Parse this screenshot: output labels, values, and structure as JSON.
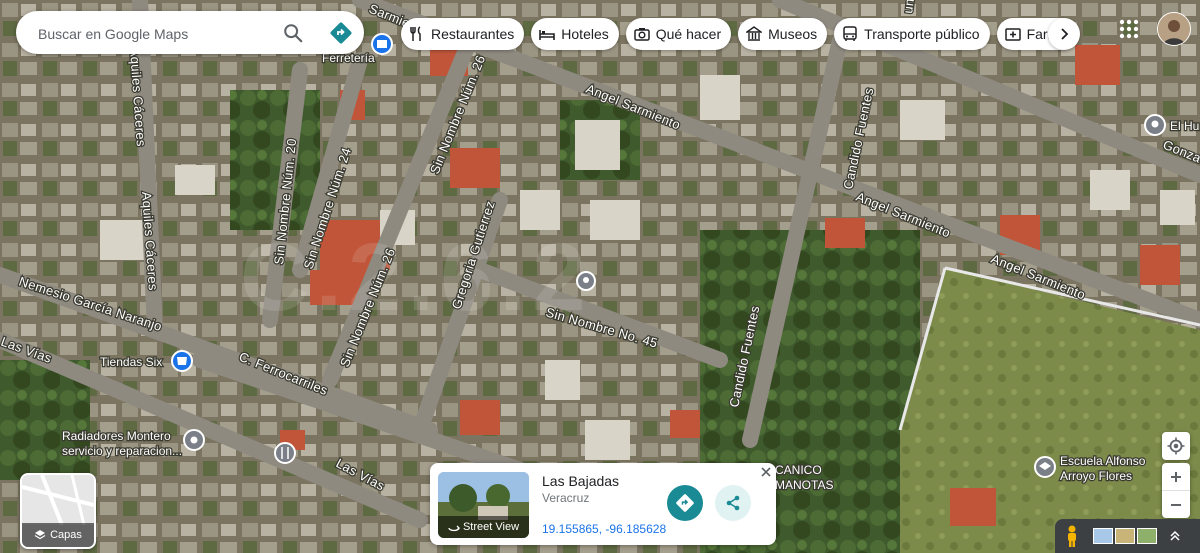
{
  "search": {
    "placeholder": "Buscar en Google Maps",
    "search_icon": "search-icon",
    "directions_icon": "directions-icon"
  },
  "chips": [
    {
      "label": "Restaurantes",
      "icon": "fork-knife-icon"
    },
    {
      "label": "Hoteles",
      "icon": "bed-icon"
    },
    {
      "label": "Qué hacer",
      "icon": "camera-icon"
    },
    {
      "label": "Museos",
      "icon": "museum-icon"
    },
    {
      "label": "Transporte público",
      "icon": "bus-icon"
    },
    {
      "label": "Farma",
      "icon": "pharmacy-icon"
    }
  ],
  "roads": {
    "angel_top": "Angel Sarmiento",
    "angel_mid": "Angel Sarmiento",
    "angel_right": "Angel Sarmiento",
    "angel_upper_left": "Sarmie",
    "aquiles_top": "Aquiles Cáceres",
    "aquiles_bottom": "Aquiles Cáceres",
    "sn20": "Sin Nombre Núm. 20",
    "sn24": "Sin Nombre Núm. 24",
    "sn26_top": "Sin Nombre Núm. 26",
    "sn26_mid": "Sin Nombre Núm. 26",
    "sn26_low": "Sin Nombre Núm. 26",
    "gregoria": "Gregoria Gutierrez",
    "sn45": "Sin Nombre No. 45",
    "candido_top": "Candido Fuentes",
    "candido_bottom": "Candido Fuentes",
    "nemesio": "Nemesio García Naranjo",
    "ferrocarriles": "C. Ferrocarriles",
    "vias_left": "Las Vías",
    "vias_bottom": "Las Vías",
    "gonza": "Gonza",
    "undi": "undi"
  },
  "places": {
    "ferreteria": "Ferretería",
    "tiendas_six": "Tiendas Six",
    "radiadores_1": "Radiadores Montero",
    "radiadores_2": "servicio y reparacion...",
    "el_hu": "El Hu",
    "escuela_1": "Escuela Alfonso",
    "escuela_2": "Arroyo Flores",
    "mecanico_1": "CANICO",
    "mecanico_2": "MANOTAS"
  },
  "watermark": "C.2.6.2",
  "layers": {
    "label": "Capas"
  },
  "card": {
    "title": "Las Bajadas",
    "subtitle": "Veracruz",
    "coordinates": "19.155865, -96.185628",
    "street_view_label": "Street View"
  },
  "colors": {
    "accent": "#1a8a94",
    "link": "#1a73e8",
    "roof_red": "#c0553a"
  }
}
